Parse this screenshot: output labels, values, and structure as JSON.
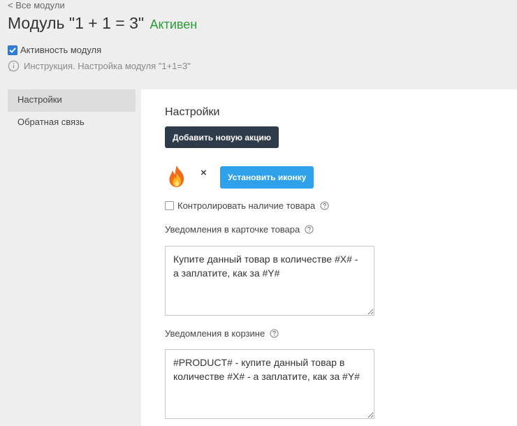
{
  "header": {
    "back_link": "< Все модули",
    "title": "Модуль \"1 + 1 = 3\"",
    "status": "Активен",
    "status_color": "#2a9a37",
    "activity_checkbox_label": "Активность модуля",
    "activity_checked": true,
    "instruction_text": "Инструкция. Настройка модуля \"1+1=3\""
  },
  "sidebar": {
    "items": [
      {
        "label": "Настройки",
        "active": true
      },
      {
        "label": "Обратная связь",
        "active": false
      }
    ]
  },
  "main": {
    "section_title": "Настройки",
    "add_action_button": "Добавить новую акцию",
    "icon_preview": "fire-icon",
    "remove_icon_symbol": "×",
    "set_icon_button": "Установить иконку",
    "control_stock_label": "Контролировать наличие товара",
    "control_stock_checked": false,
    "product_card_label": "Уведомления в карточке товара",
    "product_card_text": "Купите данный товар в количестве #X# - а заплатите, как за #Y#",
    "cart_label": "Уведомления в корзине",
    "cart_text": "#PRODUCT# - купите данный товар в количестве #X# - а заплатите, как за #Y#"
  },
  "colors": {
    "dark_button": "#2e3b4a",
    "blue_button": "#2fa1ea",
    "checkbox_accent": "#2f7fd8"
  }
}
